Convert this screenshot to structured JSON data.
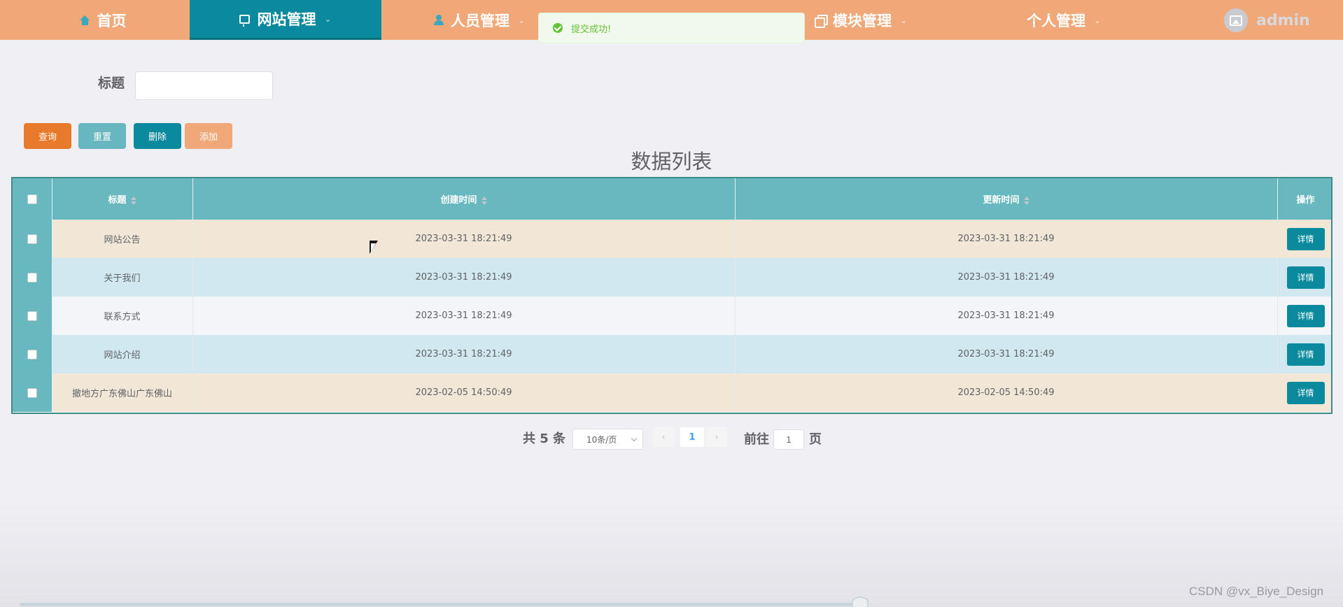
{
  "nav": {
    "home": "首页",
    "site": "网站管理",
    "people": "人员管理",
    "module": "模块管理",
    "personal": "个人管理",
    "user": "admin"
  },
  "toast": {
    "message": "提交成功!"
  },
  "search": {
    "label": "标题",
    "value": "",
    "placeholder": ""
  },
  "buttons": {
    "query": "查询",
    "reset": "重置",
    "delete": "删除",
    "add": "添加"
  },
  "list_title": "数据列表",
  "table": {
    "headers": [
      "标题",
      "创建时间",
      "更新时间",
      "操作"
    ],
    "action_label": "详情",
    "rows": [
      {
        "title": "网站公告",
        "created": "2023-03-31 18:21:49",
        "updated": "2023-03-31 18:21:49"
      },
      {
        "title": "关于我们",
        "created": "2023-03-31 18:21:49",
        "updated": "2023-03-31 18:21:49"
      },
      {
        "title": "联系方式",
        "created": "2023-03-31 18:21:49",
        "updated": "2023-03-31 18:21:49"
      },
      {
        "title": "网站介绍",
        "created": "2023-03-31 18:21:49",
        "updated": "2023-03-31 18:21:49"
      },
      {
        "title": "撤地方广东佛山广东佛山",
        "created": "2023-02-05 14:50:49",
        "updated": "2023-02-05 14:50:49"
      }
    ]
  },
  "pagination": {
    "total": "共 5 条",
    "page_size": "10条/页",
    "current_page": "1",
    "goto_label": "前往",
    "goto_value": "1",
    "page_suffix": "页"
  },
  "watermark": "CSDN @vx_Biye_Design",
  "colors": {
    "nav_bg": "#f0a878",
    "nav_active": "#0a8a9c",
    "header_bg": "#67b8bf",
    "query_btn": "#e87a2c",
    "success": "#67c23a"
  }
}
